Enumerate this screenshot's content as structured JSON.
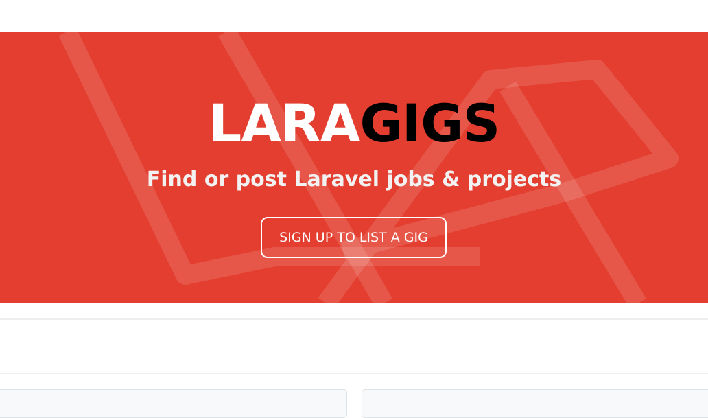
{
  "hero": {
    "title_part1": "LARA",
    "title_part2": "GIGS",
    "subtitle": "Find or post Laravel jobs & projects",
    "cta_label": "SIGN UP TO LIST A GIG",
    "background_color": "#e33e2f",
    "logo_icon": "laravel-logo-icon"
  },
  "listings": {
    "cards": [
      {
        "id": "card-1"
      },
      {
        "id": "card-2"
      }
    ]
  }
}
